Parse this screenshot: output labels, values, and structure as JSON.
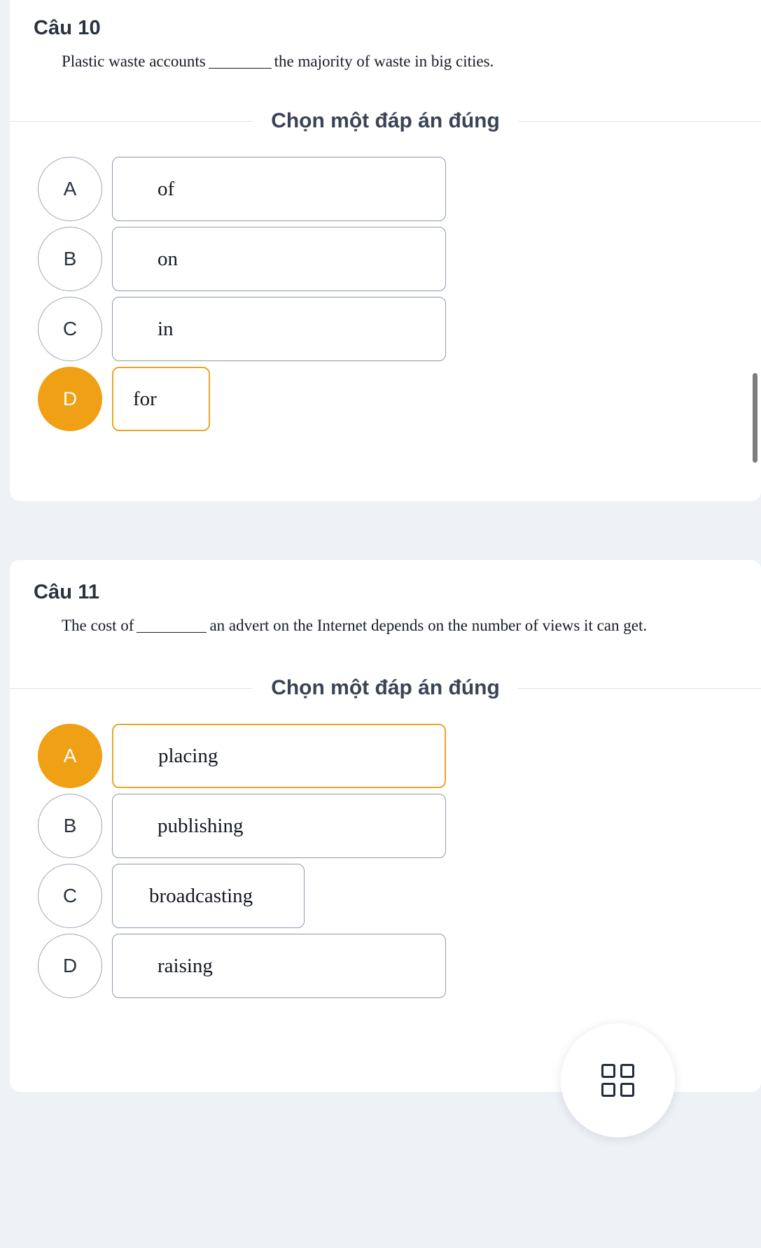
{
  "theme": {
    "accent": "#efa015",
    "accent_border": "#e9a52a",
    "page_bg": "#eef1f6",
    "card_bg": "#ffffff",
    "text_dark": "#29323f",
    "option_border": "#8d9aad"
  },
  "questions": [
    {
      "title": "Câu 10",
      "sentence_before": "Plastic waste accounts",
      "sentence_after": "the majority of waste in big cities.",
      "prompt": "Chọn một đáp án đúng",
      "options": [
        {
          "letter": "A",
          "text": "of",
          "selected": false
        },
        {
          "letter": "B",
          "text": "on",
          "selected": false
        },
        {
          "letter": "C",
          "text": "in",
          "selected": false
        },
        {
          "letter": "D",
          "text": "for",
          "selected": true
        }
      ]
    },
    {
      "title": "Câu 11",
      "sentence_before": "The cost of",
      "sentence_after": "an advert on the Internet depends on the number of views it can get.",
      "prompt": "Chọn một đáp án đúng",
      "options": [
        {
          "letter": "A",
          "text": "placing",
          "selected": true
        },
        {
          "letter": "B",
          "text": "publishing",
          "selected": false
        },
        {
          "letter": "C",
          "text": "broadcasting",
          "selected": false
        },
        {
          "letter": "D",
          "text": "raising",
          "selected": false
        }
      ]
    }
  ],
  "fab": {
    "icon": "grid-four-squares-icon"
  }
}
